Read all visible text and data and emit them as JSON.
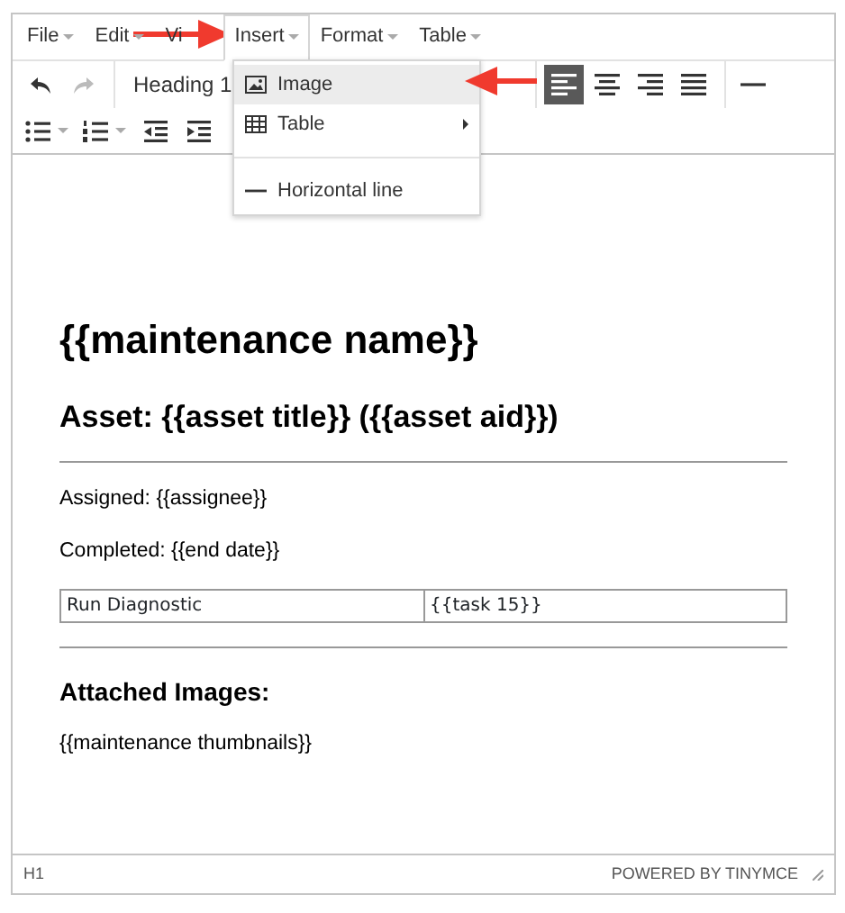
{
  "menubar": [
    {
      "label": "File",
      "caret": true,
      "selected": false
    },
    {
      "label": "Edit",
      "caret": true,
      "selected": false
    },
    {
      "label": "Vi",
      "caret": false,
      "selected": false
    },
    {
      "label": "Insert",
      "caret": true,
      "selected": true
    },
    {
      "label": "Format",
      "caret": true,
      "selected": false
    },
    {
      "label": "Table",
      "caret": true,
      "selected": false
    }
  ],
  "toolbar_rows": [
    [
      {
        "kind": "undo",
        "disabled": false
      },
      {
        "kind": "redo",
        "disabled": true
      },
      {
        "kind": "sep"
      },
      {
        "kind": "select",
        "label": "Heading 1"
      },
      {
        "kind": "sep"
      },
      {
        "kind": "align-left",
        "active": true
      },
      {
        "kind": "align-center",
        "active": false
      },
      {
        "kind": "align-right",
        "active": false
      },
      {
        "kind": "align-justify",
        "active": false
      },
      {
        "kind": "sep"
      },
      {
        "kind": "hr"
      }
    ],
    [
      {
        "kind": "bullist"
      },
      {
        "kind": "numlist"
      },
      {
        "kind": "outdent"
      },
      {
        "kind": "indent"
      }
    ]
  ],
  "insert_menu": [
    {
      "kind": "image",
      "label": "Image",
      "selected": true,
      "submenu": false
    },
    {
      "kind": "table",
      "label": "Table",
      "selected": false,
      "submenu": true
    },
    {
      "kind": "divider"
    },
    {
      "kind": "hr",
      "label": "Horizontal line",
      "selected": false,
      "submenu": false
    }
  ],
  "content": [
    {
      "kind": "h1",
      "text": "{{maintenance name}}"
    },
    {
      "kind": "h2",
      "text": "Asset: {{asset title}} ({{asset aid}})"
    },
    {
      "kind": "hr"
    },
    {
      "kind": "p",
      "text": "Assigned: {{assignee}}"
    },
    {
      "kind": "p",
      "text": "Completed: {{end date}}"
    },
    {
      "kind": "table",
      "cells": [
        "Run Diagnostic",
        "{{task 15}}"
      ]
    },
    {
      "kind": "hr"
    },
    {
      "kind": "h3",
      "text": "Attached Images:"
    },
    {
      "kind": "p",
      "text": "{{maintenance thumbnails}}"
    }
  ],
  "status_bar": {
    "path": "H1",
    "brand": "POWERED BY TINYMCE"
  },
  "annotations": [
    {
      "kind": "arrow-right"
    },
    {
      "kind": "arrow-left"
    }
  ]
}
